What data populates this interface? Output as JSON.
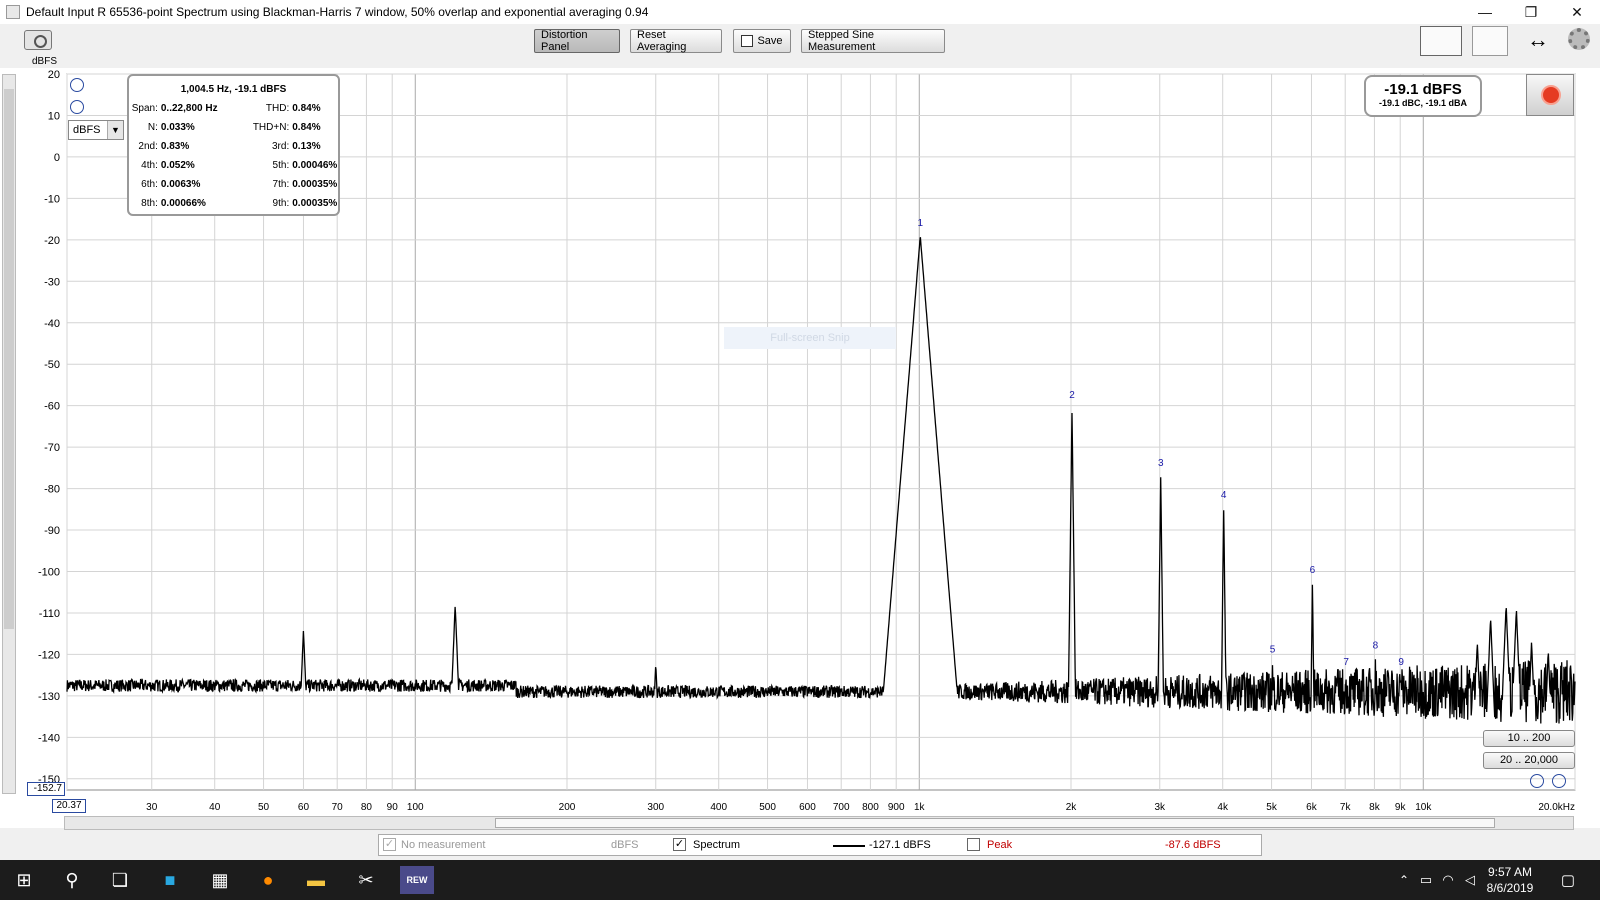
{
  "window": {
    "title": "Default Input R 65536-point Spectrum using Blackman-Harris 7 window, 50% overlap and exponential averaging 0.94",
    "minimize": "—",
    "restore": "❐",
    "close": "✕"
  },
  "toolbar": {
    "distortion_panel": "Distortion Panel",
    "reset_averaging": "Reset Averaging",
    "save": "Save",
    "stepped_sine": "Stepped Sine Measurement"
  },
  "axis": {
    "y_unit": "dBFS",
    "unit_select": "dBFS",
    "y_min_readout": "-152.7",
    "x_min_readout": "20.37"
  },
  "distortion": {
    "header": "1,004.5 Hz, -19.1 dBFS",
    "rows": [
      {
        "l1": "Span:",
        "v1": "0..22,800 Hz",
        "l2": "THD:",
        "v2": "0.84%"
      },
      {
        "l1": "N:",
        "v1": "0.033%",
        "l2": "THD+N:",
        "v2": "0.84%"
      },
      {
        "l1": "2nd:",
        "v1": "0.83%",
        "l2": "3rd:",
        "v2": "0.13%"
      },
      {
        "l1": "4th:",
        "v1": "0.052%",
        "l2": "5th:",
        "v2": "0.00046%"
      },
      {
        "l1": "6th:",
        "v1": "0.0063%",
        "l2": "7th:",
        "v2": "0.00035%"
      },
      {
        "l1": "8th:",
        "v1": "0.00066%",
        "l2": "9th:",
        "v2": "0.00035%"
      }
    ]
  },
  "level": {
    "main": "-19.1 dBFS",
    "sub": "-19.1 dBC, -19.1 dBA"
  },
  "range_buttons": [
    "10 .. 200",
    "20 .. 20,000"
  ],
  "overlay_text": "Full-screen Snip",
  "legend": {
    "no_measurement": "No measurement",
    "no_measurement_unit": "dBFS",
    "spectrum": "Spectrum",
    "spectrum_value": "-127.1 dBFS",
    "peak": "Peak",
    "peak_value": "-87.6 dBFS"
  },
  "taskbar": {
    "time": "9:57 AM",
    "date": "8/6/2019",
    "rew_label": "REW"
  },
  "colors": {
    "trace": "#000000",
    "harmonic_label": "#1a1aa8",
    "grid": "#d4d4d4",
    "grid_major": "#a9a9a9",
    "peak_label": "#c00000",
    "record": "#e53b22"
  },
  "chart_data": {
    "type": "line",
    "xscale": "log",
    "xlim": [
      20.37,
      20000
    ],
    "ylim": [
      -152.7,
      20
    ],
    "x_ticks": [
      {
        "v": 20.37,
        "label": ""
      },
      {
        "v": 30,
        "label": "30"
      },
      {
        "v": 40,
        "label": "40"
      },
      {
        "v": 50,
        "label": "50"
      },
      {
        "v": 60,
        "label": "60"
      },
      {
        "v": 70,
        "label": "70"
      },
      {
        "v": 80,
        "label": "80"
      },
      {
        "v": 90,
        "label": "90"
      },
      {
        "v": 100,
        "label": "100"
      },
      {
        "v": 200,
        "label": "200"
      },
      {
        "v": 300,
        "label": "300"
      },
      {
        "v": 400,
        "label": "400"
      },
      {
        "v": 500,
        "label": "500"
      },
      {
        "v": 600,
        "label": "600"
      },
      {
        "v": 700,
        "label": "700"
      },
      {
        "v": 800,
        "label": "800"
      },
      {
        "v": 900,
        "label": "900"
      },
      {
        "v": 1000,
        "label": "1k"
      },
      {
        "v": 2000,
        "label": "2k"
      },
      {
        "v": 3000,
        "label": "3k"
      },
      {
        "v": 4000,
        "label": "4k"
      },
      {
        "v": 5000,
        "label": "5k"
      },
      {
        "v": 6000,
        "label": "6k"
      },
      {
        "v": 7000,
        "label": "7k"
      },
      {
        "v": 8000,
        "label": "8k"
      },
      {
        "v": 9000,
        "label": "9k"
      },
      {
        "v": 10000,
        "label": "10k"
      },
      {
        "v": 20000,
        "label": "20.0kHz"
      }
    ],
    "y_ticks": [
      20,
      10,
      0,
      -10,
      -20,
      -30,
      -40,
      -50,
      -60,
      -70,
      -80,
      -90,
      -100,
      -110,
      -120,
      -130,
      -140,
      -150
    ],
    "noise_floor": -129,
    "spurs": [
      {
        "f": 60,
        "db": -114
      },
      {
        "f": 120,
        "db": -108
      },
      {
        "f": 300,
        "db": -122
      },
      {
        "f": 860,
        "db": -126
      },
      {
        "f": 12800,
        "db": -117
      },
      {
        "f": 13600,
        "db": -111
      },
      {
        "f": 14600,
        "db": -108
      },
      {
        "f": 15300,
        "db": -109
      },
      {
        "f": 16400,
        "db": -117
      },
      {
        "f": 17700,
        "db": -119
      }
    ],
    "harmonics": [
      {
        "n": "1",
        "f": 1004.5,
        "db": -19.1
      },
      {
        "n": "2",
        "f": 2009,
        "db": -60.6
      },
      {
        "n": "3",
        "f": 3013.5,
        "db": -77
      },
      {
        "n": "4",
        "f": 4018,
        "db": -84.7
      },
      {
        "n": "5",
        "f": 5022.5,
        "db": -122
      },
      {
        "n": "6",
        "f": 6027,
        "db": -102.8
      },
      {
        "n": "7",
        "f": 7031.5,
        "db": -125
      },
      {
        "n": "8",
        "f": 8036,
        "db": -121
      },
      {
        "n": "9",
        "f": 9040.5,
        "db": -125
      }
    ]
  }
}
